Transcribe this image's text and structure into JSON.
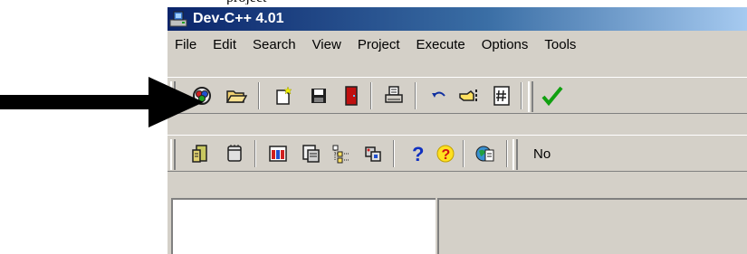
{
  "caption_fragment": "    project",
  "window": {
    "title": "Dev-C++ 4.01"
  },
  "menubar": {
    "items": [
      "File",
      "Edit",
      "Search",
      "View",
      "Project",
      "Execute",
      "Options",
      "Tools"
    ]
  },
  "toolbar_main": {
    "buttons": [
      {
        "icon": "new-project-icon"
      },
      {
        "icon": "open-folder-icon"
      },
      {
        "icon": "new-file-icon"
      },
      {
        "icon": "save-icon"
      },
      {
        "icon": "close-door-icon"
      },
      {
        "icon": "print-icon"
      },
      {
        "icon": "undo-icon"
      },
      {
        "icon": "find-icon"
      },
      {
        "icon": "goto-line-icon"
      },
      {
        "icon": "compile-check-icon"
      }
    ]
  },
  "toolbar_secondary": {
    "buttons": [
      {
        "icon": "add-to-project-icon"
      },
      {
        "icon": "remove-from-project-icon"
      },
      {
        "icon": "compile-run-icon"
      },
      {
        "icon": "debug-icon"
      },
      {
        "icon": "class-browser-icon"
      },
      {
        "icon": "options-icon"
      },
      {
        "icon": "help-icon"
      },
      {
        "icon": "about-icon"
      },
      {
        "icon": "web-icon"
      }
    ],
    "trailing_text": "No"
  },
  "annotation": {
    "arrow_color": "#000000",
    "points_to": "new-project-icon"
  }
}
